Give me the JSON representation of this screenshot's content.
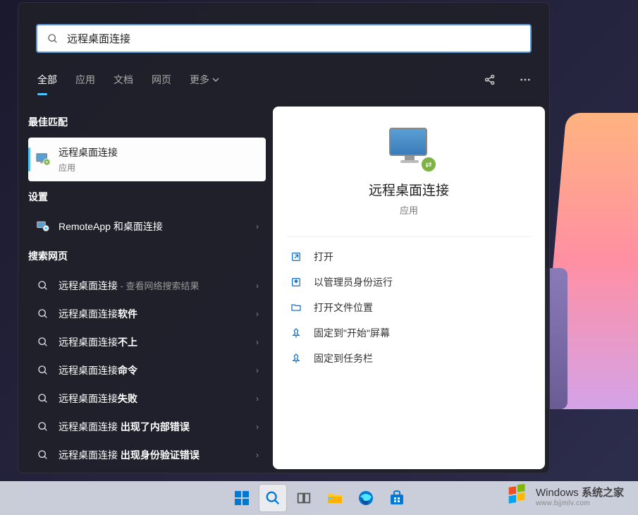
{
  "search": {
    "query": "远程桌面连接"
  },
  "tabs": {
    "all": "全部",
    "apps": "应用",
    "docs": "文档",
    "web": "网页",
    "more": "更多"
  },
  "sections": {
    "best": "最佳匹配",
    "settings": "设置",
    "web": "搜索网页"
  },
  "best": {
    "title": "远程桌面连接",
    "sub": "应用"
  },
  "settings": [
    {
      "label": "RemoteApp 和桌面连接"
    }
  ],
  "web_results": [
    {
      "q": "远程桌面连接",
      "suffix": " - 查看网络搜索结果",
      "bold": ""
    },
    {
      "q": "远程桌面连接",
      "suffix": "",
      "bold": "软件"
    },
    {
      "q": "远程桌面连接",
      "suffix": "",
      "bold": "不上"
    },
    {
      "q": "远程桌面连接",
      "suffix": "",
      "bold": "命令"
    },
    {
      "q": "远程桌面连接",
      "suffix": "",
      "bold": "失败"
    },
    {
      "q": "远程桌面连接 ",
      "suffix": "",
      "bold": "出现了内部错误"
    },
    {
      "q": "远程桌面连接 ",
      "suffix": "",
      "bold": "出现身份验证错误"
    }
  ],
  "preview": {
    "title": "远程桌面连接",
    "sub": "应用"
  },
  "actions": {
    "open": "打开",
    "admin": "以管理员身份运行",
    "location": "打开文件位置",
    "pin_start": "固定到\"开始\"屏幕",
    "pin_taskbar": "固定到任务栏"
  },
  "watermark": {
    "line1a": "Windows",
    "line1b": "系统之家",
    "line2": "www.bjjmlv.com"
  }
}
